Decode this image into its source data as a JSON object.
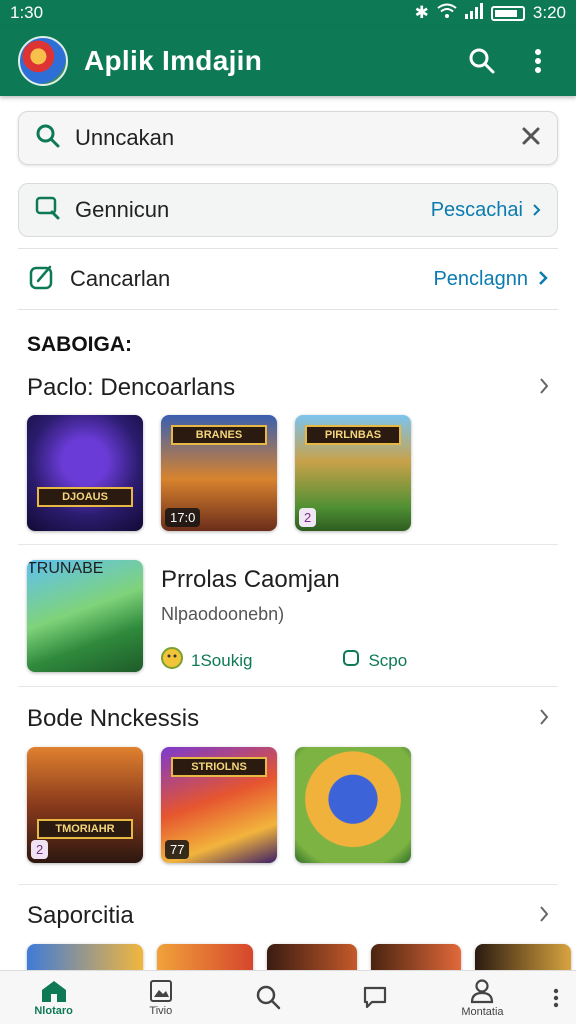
{
  "status": {
    "time": "1:30",
    "clock_right": "3:20"
  },
  "app_bar": {
    "title": "Aplik Imdajin"
  },
  "search": {
    "value": "Unncakan"
  },
  "filter_row": {
    "label": "Gennicun",
    "link": "Pescachai"
  },
  "nav_row": {
    "label": "Cancarlan",
    "link": "Penclagnn"
  },
  "caption": "SABOIGA:",
  "sections": [
    {
      "title": "Paclo: Dencoarlans",
      "items": [
        {
          "banner": "DJOAUS",
          "badge": ""
        },
        {
          "banner": "BRANES",
          "badge": "17:0"
        },
        {
          "banner": "PIRLNBAS",
          "badge": "2"
        }
      ]
    },
    {
      "title": "Bode Nnckessis",
      "items": [
        {
          "banner": "TMORIAHR",
          "badge": "2"
        },
        {
          "banner": "STRIOLNS",
          "badge": "77"
        },
        {
          "banner": "",
          "badge": ""
        }
      ]
    },
    {
      "title": "Saporcitia"
    }
  ],
  "featured": {
    "title": "Prrolas Caomjan",
    "subtitle": "Nlpaodoonebn)",
    "banner": "TRUNABE",
    "meta_left": "1Soukig",
    "meta_right": "Scpo"
  },
  "bottom_nav": [
    {
      "label": "Nlotaro"
    },
    {
      "label": "Tivio"
    },
    {
      "label": ""
    },
    {
      "label": ""
    },
    {
      "label": "Montatia"
    }
  ],
  "colors": {
    "brand": "#0e7a55",
    "link": "#0b7bb0"
  }
}
